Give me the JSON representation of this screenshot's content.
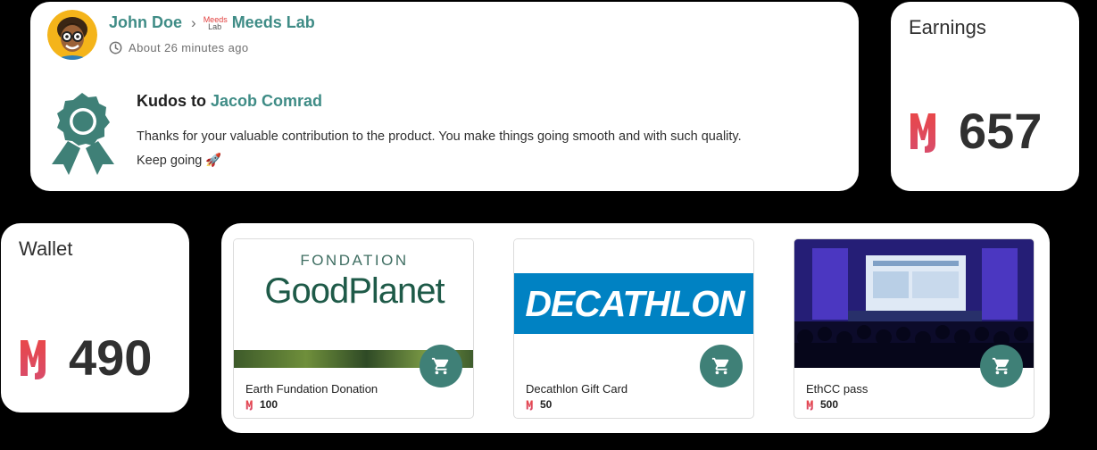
{
  "activity": {
    "author": "John Doe",
    "space_logo": {
      "top": "Meeds",
      "bottom": "Lab"
    },
    "space": "Meeds Lab",
    "time": "About 26 minutes ago",
    "kudos_prefix": "Kudos to",
    "recipient": "Jacob Comrad",
    "message_line1": "Thanks for your valuable contribution to the product. You make things going smooth and with such quality.",
    "message_line2": "Keep going",
    "message_emoji": "🚀"
  },
  "earnings": {
    "label": "Earnings",
    "value": "657"
  },
  "wallet": {
    "label": "Wallet",
    "value": "490"
  },
  "perks": [
    {
      "name": "Earth Fundation Donation",
      "price": "100",
      "image_top": "FONDATION",
      "image_main": "GoodPlanet"
    },
    {
      "name": "Decathlon Gift Card",
      "price": "50",
      "image_main": "DECATHLON"
    },
    {
      "name": "EthCC pass",
      "price": "500"
    }
  ],
  "colors": {
    "accent": "#3f8c86",
    "meeds_red": "#e2403f",
    "cart": "#3f8077",
    "decathlon_blue": "#0082c3"
  },
  "icons": {
    "time": "clock-icon",
    "kudos": "ribbon-award-icon",
    "cart": "shopping-cart-icon",
    "currency": "meeds-token-icon"
  }
}
